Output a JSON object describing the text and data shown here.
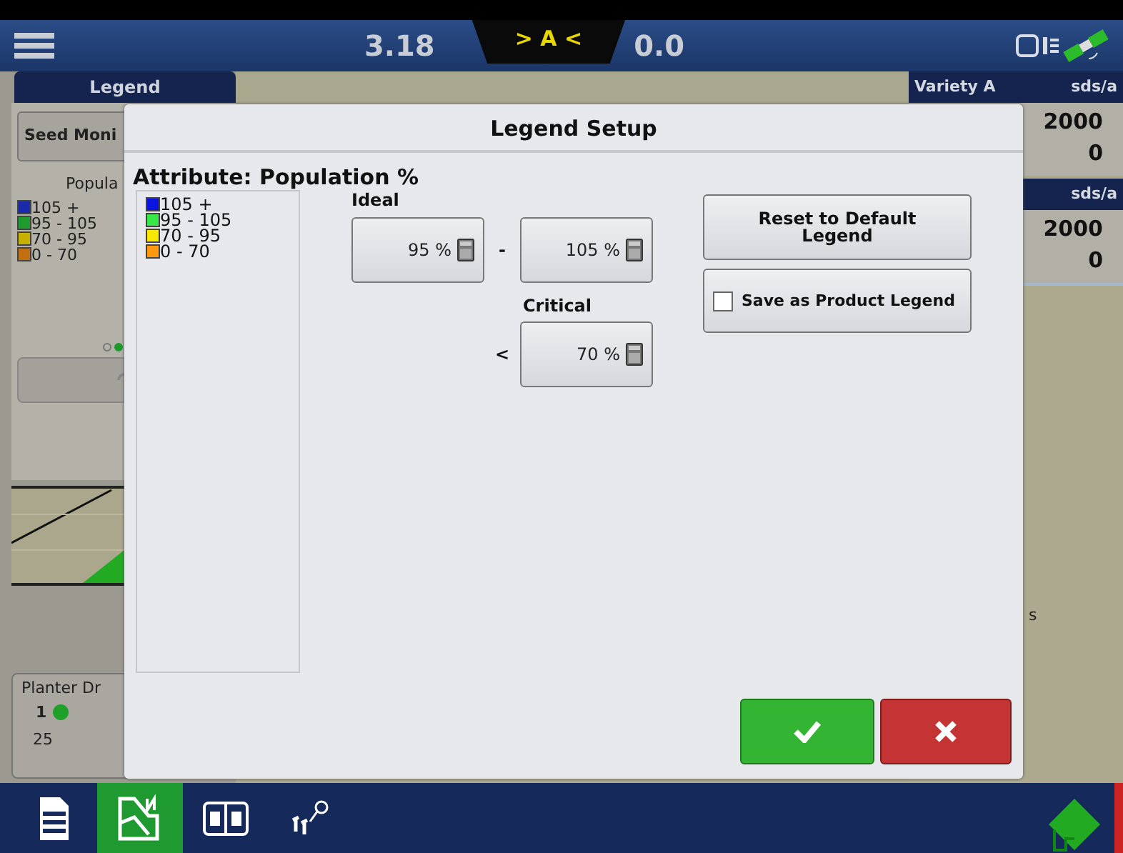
{
  "top_bar": {
    "left_value": "3.18",
    "guidance": "> A <",
    "right_value": "0.0"
  },
  "left_panel": {
    "tab": "Legend",
    "button": "Seed Moni",
    "legend_title": "Popula",
    "legend_items": [
      {
        "label": "105 +",
        "color": "#1a2aa8"
      },
      {
        "label": "95 - 105",
        "color": "#1f9a2e"
      },
      {
        "label": "70 - 95",
        "color": "#c8b000"
      },
      {
        "label": "0 - 70",
        "color": "#c07010"
      }
    ],
    "pages": [
      {
        "selected": false
      },
      {
        "selected": true
      }
    ],
    "planter_card": {
      "title": "Planter Dr",
      "row": "1",
      "count": "25"
    }
  },
  "right_panel": {
    "blocks": [
      {
        "header": "Variety A",
        "unit": "sds/a",
        "values": [
          "2000",
          "0"
        ]
      },
      {
        "unit": "sds/a",
        "values": [
          "2000",
          "0"
        ]
      }
    ],
    "fragment": "s"
  },
  "bottom_bar": {
    "tabs": [
      {
        "kind": "document",
        "selected": false
      },
      {
        "kind": "map",
        "selected": true
      },
      {
        "kind": "split",
        "selected": false
      },
      {
        "kind": "plants",
        "selected": false
      }
    ]
  },
  "dialog": {
    "title": "Legend Setup",
    "attribute": "Attribute: Population %",
    "legend_items": [
      {
        "label": "105 +",
        "color": "#0a14e0"
      },
      {
        "label": "95 - 105",
        "color": "#38e848"
      },
      {
        "label": "70 - 95",
        "color": "#f8e800"
      },
      {
        "label": "0 - 70",
        "color": "#ff9a10"
      }
    ],
    "ideal_label": "Ideal",
    "ideal_min": "95 %",
    "separator": "-",
    "ideal_max": "105 %",
    "critical_label": "Critical",
    "critical_operator": "<",
    "critical_value": "70 %",
    "reset_button": "Reset to Default Legend",
    "save_option": {
      "label": "Save as Product Legend",
      "checked": false
    }
  }
}
